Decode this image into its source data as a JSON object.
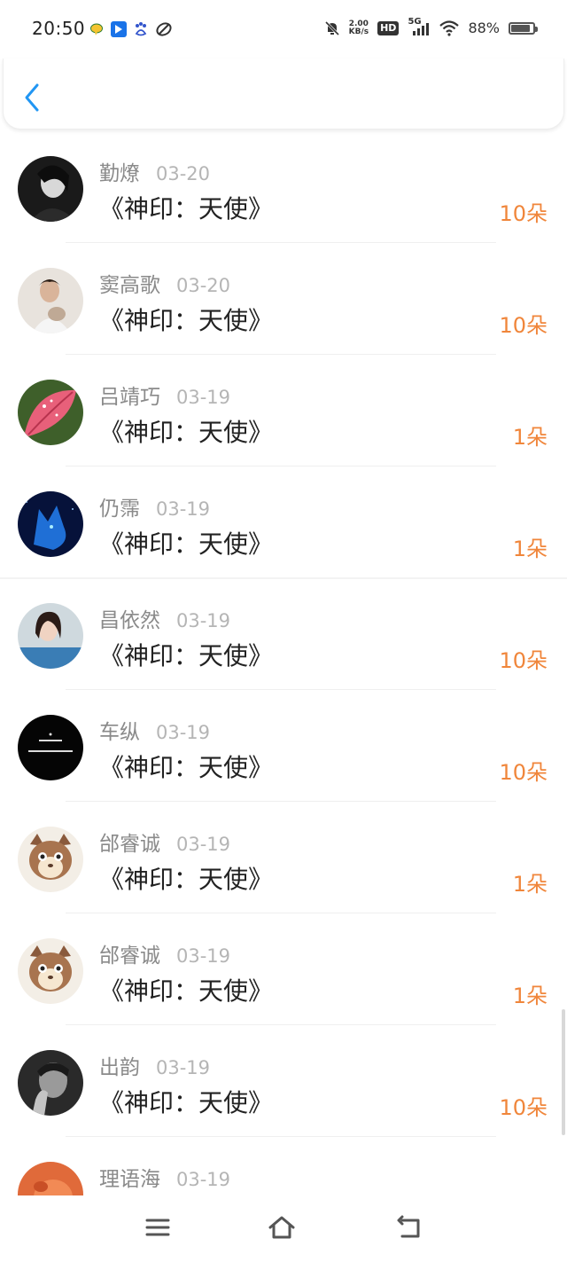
{
  "status": {
    "time": "20:50",
    "speed_top": "2.00",
    "speed_bottom": "KB/s",
    "hd": "HD",
    "network": "5G",
    "battery_text": "88%",
    "battery_level": 0.88
  },
  "colors": {
    "accent": "#2196f3",
    "amount": "#f0863b",
    "name": "#8a8a8a",
    "date": "#b5b5b5"
  },
  "list": [
    {
      "name": "勤燎",
      "date": "03-20",
      "title": "《神印：天使》",
      "amount": "10朵",
      "avatar": "dark-portrait-avatar"
    },
    {
      "name": "窦高歌",
      "date": "03-20",
      "title": "《神印：天使》",
      "amount": "10朵",
      "avatar": "boy-with-cat-avatar"
    },
    {
      "name": "吕靖巧",
      "date": "03-19",
      "title": "《神印：天使》",
      "amount": "1朵",
      "avatar": "pink-leaf-avatar"
    },
    {
      "name": "仍霈",
      "date": "03-19",
      "title": "《神印：天使》",
      "amount": "1朵",
      "avatar": "blue-wolf-avatar"
    },
    {
      "name": "昌依然",
      "date": "03-19",
      "title": "《神印：天使》",
      "amount": "10朵",
      "avatar": "girl-portrait-avatar"
    },
    {
      "name": "车纵",
      "date": "03-19",
      "title": "《神印：天使》",
      "amount": "10朵",
      "avatar": "black-text-avatar"
    },
    {
      "name": "邰睿诚",
      "date": "03-19",
      "title": "《神印：天使》",
      "amount": "1朵",
      "avatar": "cartoon-cat-avatar"
    },
    {
      "name": "邰睿诚",
      "date": "03-19",
      "title": "《神印：天使》",
      "amount": "1朵",
      "avatar": "cartoon-cat-avatar"
    },
    {
      "name": "出韵",
      "date": "03-19",
      "title": "《神印：天使》",
      "amount": "10朵",
      "avatar": "bw-man-avatar"
    },
    {
      "name": "理语海",
      "date": "03-19",
      "title": "",
      "amount": "",
      "avatar": "orange-avatar"
    }
  ]
}
